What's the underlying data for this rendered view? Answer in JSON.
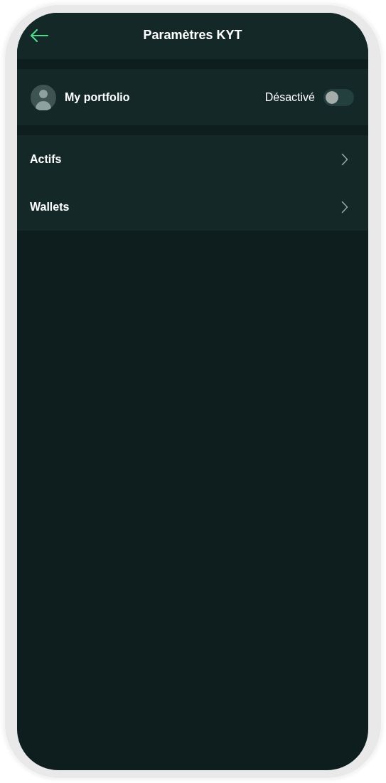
{
  "header": {
    "title": "Paramètres KYT"
  },
  "portfolio": {
    "name": "My portfolio",
    "status": "Désactivé",
    "on": false
  },
  "menu": [
    {
      "label": "Actifs"
    },
    {
      "label": "Wallets"
    }
  ]
}
